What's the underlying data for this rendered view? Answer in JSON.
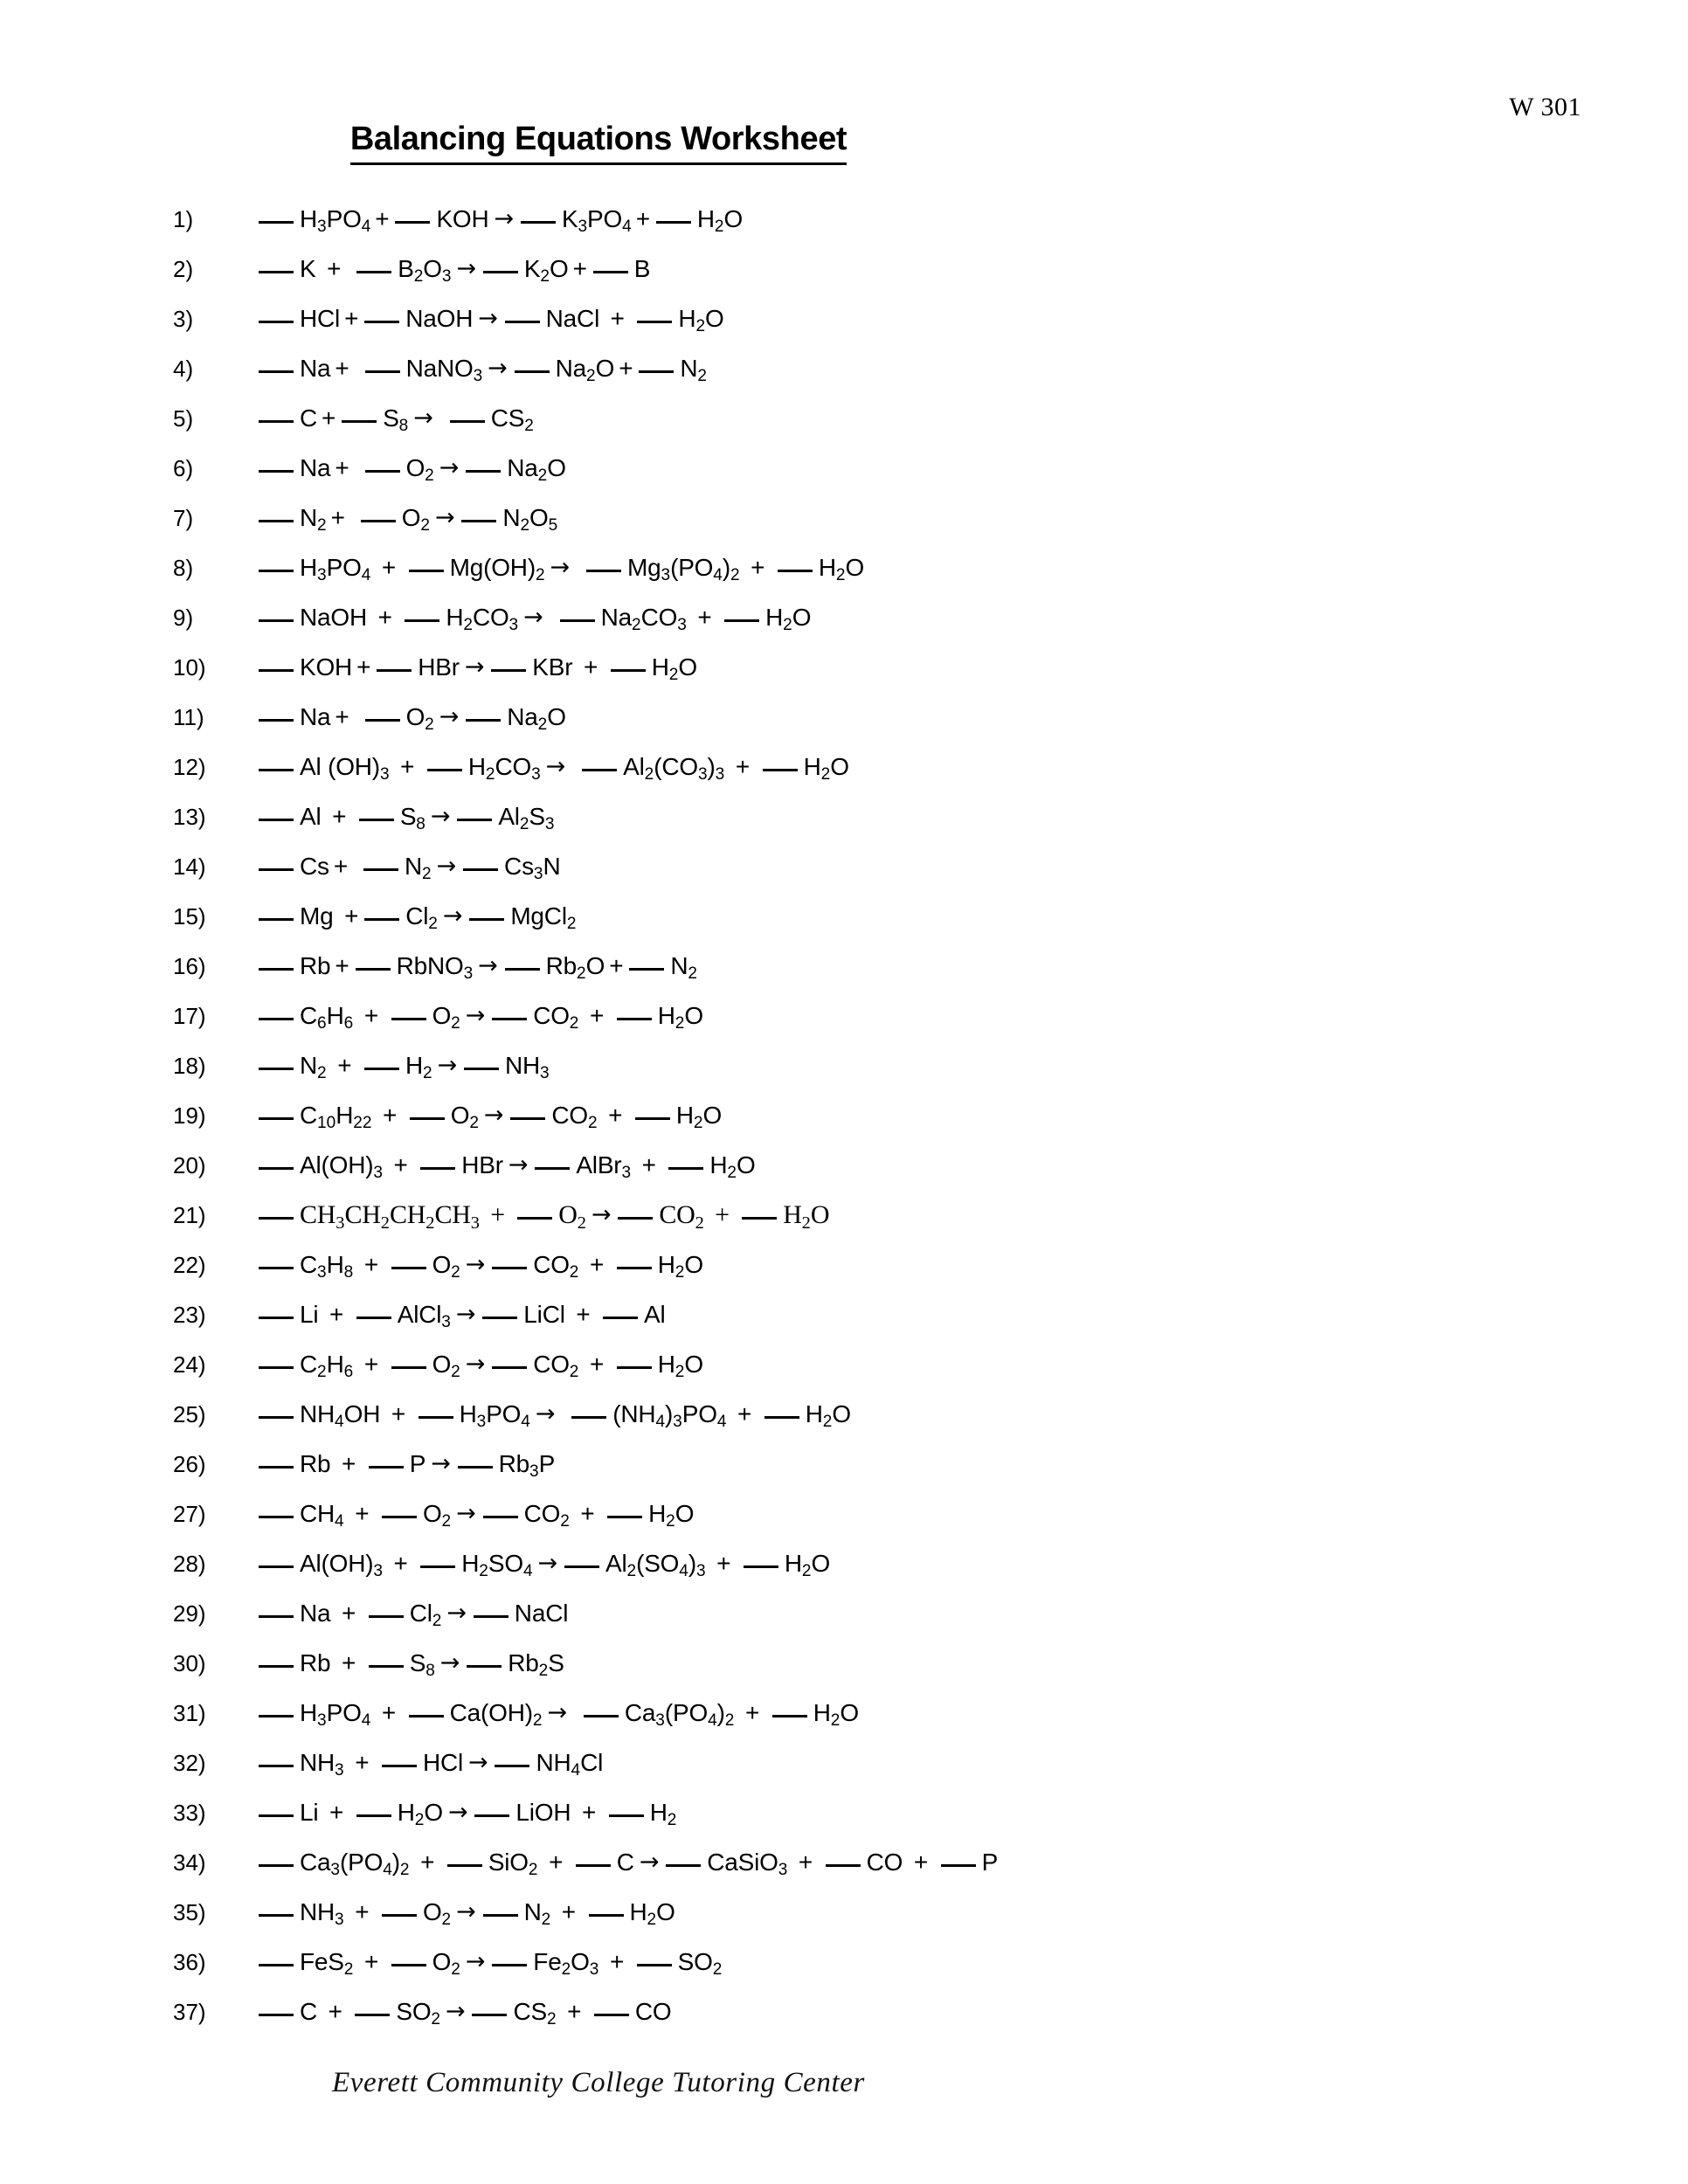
{
  "header": {
    "doc_code": "W 301",
    "title": "Balancing Equations Worksheet"
  },
  "footer": {
    "text": "Everett Community College Tutoring Center"
  },
  "symbols": {
    "plus": "+",
    "arrow": "→",
    "blank": "___"
  },
  "equations": [
    {
      "number": "1)",
      "text": "___ H3PO4 + ___ KOH → ___ K3PO4 + ___ H2O",
      "reactants": [
        "H3PO4",
        "KOH"
      ],
      "products": [
        "K3PO4",
        "H2O"
      ],
      "html": "<span class='blank'></span>H<sub>3</sub>PO<sub>4</sub><span class='op'>+</span><span class='blank'></span>KOH<span class='arrow'>→</span><span class='blank'></span>K<sub>3</sub>PO<sub>4</sub><span class='op'>+</span><span class='blank'></span>H<sub>2</sub>O"
    },
    {
      "number": "2)",
      "text": "___ K + ___ B2O3 → ___ K2O + ___ B",
      "reactants": [
        "K",
        "B2O3"
      ],
      "products": [
        "K2O",
        "B"
      ],
      "html": "<span class='blank'></span>K<span class='op'>&nbsp;+</span><span class='sp'></span><span class='blank'></span>B<sub>2</sub>O<sub>3</sub><span class='arrow'>→</span><span class='blank'></span>K<sub>2</sub>O<span class='op'>+</span><span class='blank'></span>B"
    },
    {
      "number": "3)",
      "text": "___ HCl + ___ NaOH → ___ NaCl + ___ H2O",
      "reactants": [
        "HCl",
        "NaOH"
      ],
      "products": [
        "NaCl",
        "H2O"
      ],
      "html": "<span class='blank'></span>HCl<span class='op'>+</span><span class='blank'></span>NaOH<span class='arrow'>→</span><span class='blank'></span>NaCl<span class='op'>&nbsp;+&nbsp;</span><span class='blank'></span>H<sub>2</sub>O"
    },
    {
      "number": "4)",
      "text": "___ Na + ___ NaNO3 → ___ Na2O + ___ N2",
      "reactants": [
        "Na",
        "NaNO3"
      ],
      "products": [
        "Na2O",
        "N2"
      ],
      "html": "<span class='blank'></span>Na<span class='op'>+</span><span class='sp'></span><span class='blank'></span>NaNO<sub>3</sub><span class='arrow'>→</span><span class='blank'></span>Na<sub>2</sub>O<span class='op'>+</span><span class='blank'></span>N<sub>2</sub>"
    },
    {
      "number": "5)",
      "text": "___ C + ___ S8 → ___ CS2",
      "reactants": [
        "C",
        "S8"
      ],
      "products": [
        "CS2"
      ],
      "html": "<span class='blank'></span>C<span class='op'>+</span><span class='blank'></span>S<sub>8</sub><span class='arrow'>→</span><span class='sp'></span><span class='blank'></span>CS<sub>2</sub>"
    },
    {
      "number": "6)",
      "text": "___ Na + ___ O2 → ___ Na2O",
      "reactants": [
        "Na",
        "O2"
      ],
      "products": [
        "Na2O"
      ],
      "html": "<span class='blank'></span>Na<span class='op'>+</span><span class='sp'></span><span class='blank'></span>O<sub>2</sub><span class='arrow'>→</span><span class='blank'></span>Na<sub>2</sub>O"
    },
    {
      "number": "7)",
      "text": "___ N2 + ___ O2 → ___ N2O5",
      "reactants": [
        "N2",
        "O2"
      ],
      "products": [
        "N2O5"
      ],
      "html": "<span class='blank'></span>N<sub>2</sub><span class='op'>+</span><span class='sp'></span><span class='blank'></span>O<sub>2</sub><span class='arrow'>→</span><span class='blank'></span>N<sub>2</sub>O<sub>5</sub>"
    },
    {
      "number": "8)",
      "text": "___ H3PO4 + ___ Mg(OH)2 → ___ Mg3(PO4)2 + ___ H2O",
      "reactants": [
        "H3PO4",
        "Mg(OH)2"
      ],
      "products": [
        "Mg3(PO4)2",
        "H2O"
      ],
      "html": "<span class='blank'></span>H<sub>3</sub>PO<sub>4</sub><span class='op'>&nbsp;+&nbsp;</span><span class='blank'></span>Mg(OH)<sub>2</sub><span class='arrow'>→</span><span class='sp'></span><span class='blank'></span>Mg<sub>3</sub>(PO<sub>4</sub>)<sub>2</sub><span class='op'>&nbsp;+&nbsp;</span><span class='blank'></span>H<sub>2</sub>O"
    },
    {
      "number": "9)",
      "text": "___ NaOH + ___ H2CO3 → ___ Na2CO3 + ___ H2O",
      "reactants": [
        "NaOH",
        "H2CO3"
      ],
      "products": [
        "Na2CO3",
        "H2O"
      ],
      "html": "<span class='blank'></span>NaOH<span class='op'>&nbsp;+&nbsp;</span><span class='blank'></span>H<sub>2</sub>CO<sub>3</sub><span class='arrow'>→</span><span class='sp'></span><span class='blank'></span>Na<sub>2</sub>CO<sub>3</sub><span class='op'>&nbsp;+&nbsp;</span><span class='blank'></span>H<sub>2</sub>O"
    },
    {
      "number": "10)",
      "text": "___ KOH + ___ HBr → ___ KBr + ___ H2O",
      "reactants": [
        "KOH",
        "HBr"
      ],
      "products": [
        "KBr",
        "H2O"
      ],
      "html": "<span class='blank'></span>KOH<span class='op'>+</span><span class='blank'></span>HBr<span class='arrow'>→</span><span class='blank'></span>KBr<span class='op'>&nbsp;+&nbsp;</span><span class='blank'></span>H<sub>2</sub>O"
    },
    {
      "number": "11)",
      "text": "___ Na + ___ O2 → ___ Na2O",
      "reactants": [
        "Na",
        "O2"
      ],
      "products": [
        "Na2O"
      ],
      "html": "<span class='blank'></span>Na<span class='op'>+</span><span class='sp'></span><span class='blank'></span>O<sub>2</sub><span class='arrow'>→</span><span class='blank'></span>Na<sub>2</sub>O"
    },
    {
      "number": "12)",
      "text": "___ Al (OH)3 + ___ H2CO3 → ___ Al2(CO3)3 + ___ H2O",
      "reactants": [
        "Al (OH)3",
        "H2CO3"
      ],
      "products": [
        "Al2(CO3)3",
        "H2O"
      ],
      "html": "<span class='blank'></span>Al (OH)<sub>3</sub><span class='op'>&nbsp;+&nbsp;</span><span class='blank'></span>H<sub>2</sub>CO<sub>3</sub><span class='arrow'>→</span><span class='sp'></span><span class='blank'></span>Al<sub>2</sub>(CO<sub>3</sub>)<sub>3</sub><span class='op'>&nbsp;+&nbsp;</span><span class='blank'></span>H<sub>2</sub>O"
    },
    {
      "number": "13)",
      "text": "___ Al + ___ S8 → ___ Al2S3",
      "reactants": [
        "Al",
        "S8"
      ],
      "products": [
        "Al2S3"
      ],
      "html": "<span class='blank'></span>Al<span class='op'>&nbsp;+&nbsp;</span><span class='blank'></span>S<sub>8</sub><span class='arrow'>→</span><span class='blank'></span>Al<sub>2</sub>S<sub>3</sub>"
    },
    {
      "number": "14)",
      "text": "___ Cs + ___ N2 → ___ Cs3N",
      "reactants": [
        "Cs",
        "N2"
      ],
      "products": [
        "Cs3N"
      ],
      "html": "<span class='blank'></span>Cs<span class='op'>+</span><span class='sp'></span><span class='blank'></span>N<sub>2</sub><span class='arrow'>→</span><span class='blank'></span>Cs<sub>3</sub>N"
    },
    {
      "number": "15)",
      "text": "___ Mg + ___ Cl2 → ___ MgCl2",
      "reactants": [
        "Mg",
        "Cl2"
      ],
      "products": [
        "MgCl2"
      ],
      "html": "<span class='blank'></span>Mg<span class='op'>&nbsp;+</span><span class='blank'></span>Cl<sub>2</sub><span class='arrow'>→</span><span class='blank'></span>MgCl<sub>2</sub>"
    },
    {
      "number": "16)",
      "text": "___ Rb + ___ RbNO3 → ___ Rb2O + ___ N2",
      "reactants": [
        "Rb",
        "RbNO3"
      ],
      "products": [
        "Rb2O",
        "N2"
      ],
      "html": "<span class='blank'></span>Rb<span class='op'>+</span><span class='blank'></span>RbNO<sub>3</sub><span class='arrow'>→</span><span class='blank'></span>Rb<sub>2</sub>O<span class='op'>+</span><span class='blank'></span>N<sub>2</sub>"
    },
    {
      "number": "17)",
      "text": "___ C6H6 + ___ O2 → ___ CO2 + ___ H2O",
      "reactants": [
        "C6H6",
        "O2"
      ],
      "products": [
        "CO2",
        "H2O"
      ],
      "html": "<span class='blank'></span>C<sub>6</sub>H<sub>6</sub><span class='op'>&nbsp;+&nbsp;</span><span class='blank'></span>O<sub>2</sub><span class='arrow'>→</span><span class='blank'></span>CO<sub>2</sub><span class='op'>&nbsp;+&nbsp;</span><span class='blank'></span>H<sub>2</sub>O"
    },
    {
      "number": "18)",
      "text": "___ N2 + ___ H2 → ___ NH3",
      "reactants": [
        "N2",
        "H2"
      ],
      "products": [
        "NH3"
      ],
      "html": "<span class='blank'></span>N<sub>2</sub><span class='op'>&nbsp;+&nbsp;</span><span class='blank'></span>H<sub>2</sub><span class='arrow'>→</span><span class='blank'></span>NH<sub>3</sub>"
    },
    {
      "number": "19)",
      "text": "___ C10H22 + ___ O2 → ___ CO2 + ___ H2O",
      "reactants": [
        "C10H22",
        "O2"
      ],
      "products": [
        "CO2",
        "H2O"
      ],
      "html": "<span class='blank'></span>C<sub>10</sub>H<sub>22</sub><span class='op'>&nbsp;+&nbsp;</span><span class='blank'></span>O<sub>2</sub><span class='arrow'>→</span><span class='blank'></span>CO<sub>2</sub><span class='op'>&nbsp;+&nbsp;</span><span class='blank'></span>H<sub>2</sub>O"
    },
    {
      "number": "20)",
      "text": "___ Al(OH)3 + ___ HBr → ___ AlBr3 + ___ H2O",
      "reactants": [
        "Al(OH)3",
        "HBr"
      ],
      "products": [
        "AlBr3",
        "H2O"
      ],
      "html": "<span class='blank'></span>Al(OH)<sub>3</sub><span class='op'>&nbsp;+&nbsp;</span><span class='blank'></span>HBr<span class='arrow'>→</span><span class='blank'></span>AlBr<sub>3</sub><span class='op'>&nbsp;+&nbsp;</span><span class='blank'></span>H<sub>2</sub>O"
    },
    {
      "number": "21)",
      "serif": true,
      "text": "___ CH3CH2CH2CH3 + ___ O2 → ___ CO2 + ___ H2O",
      "reactants": [
        "CH3CH2CH2CH3",
        "O2"
      ],
      "products": [
        "CO2",
        "H2O"
      ],
      "html": "<span class='blank'></span>CH<sub>3</sub>CH<sub>2</sub>CH<sub>2</sub>CH<sub>3</sub><span class='op'>&nbsp;+&nbsp;</span><span class='blank'></span>O<sub>2</sub><span class='arrow'>→</span><span class='blank'></span>CO<sub>2</sub><span class='op'>&nbsp;+&nbsp;</span><span class='blank'></span>H<sub>2</sub>O"
    },
    {
      "number": "22)",
      "text": "___ C3H8 + ___ O2 → ___ CO2 + ___ H2O",
      "reactants": [
        "C3H8",
        "O2"
      ],
      "products": [
        "CO2",
        "H2O"
      ],
      "html": "<span class='blank'></span>C<sub>3</sub>H<sub>8</sub><span class='op'>&nbsp;+&nbsp;</span><span class='blank'></span>O<sub>2</sub><span class='arrow'>→</span><span class='blank'></span>CO<sub>2</sub><span class='op'>&nbsp;+&nbsp;</span><span class='blank'></span>H<sub>2</sub>O"
    },
    {
      "number": "23)",
      "text": "___ Li + ___ AlCl3 → ___ LiCl + ___ Al",
      "reactants": [
        "Li",
        "AlCl3"
      ],
      "products": [
        "LiCl",
        "Al"
      ],
      "html": "<span class='blank'></span>Li<span class='op'>&nbsp;+&nbsp;</span><span class='blank'></span>AlCl<sub>3</sub><span class='arrow'>→</span><span class='blank'></span>LiCl<span class='op'>&nbsp;+&nbsp;</span><span class='blank'></span>Al"
    },
    {
      "number": "24)",
      "text": "___ C2H6 + ___ O2 → ___ CO2 + ___ H2O",
      "reactants": [
        "C2H6",
        "O2"
      ],
      "products": [
        "CO2",
        "H2O"
      ],
      "html": "<span class='blank'></span>C<sub>2</sub>H<sub>6</sub><span class='op'>&nbsp;+&nbsp;</span><span class='blank'></span>O<sub>2</sub><span class='arrow'>→</span><span class='blank'></span>CO<sub>2</sub><span class='op'>&nbsp;+&nbsp;</span><span class='blank'></span>H<sub>2</sub>O"
    },
    {
      "number": "25)",
      "text": "___ NH4OH + ___ H3PO4 → ___ (NH4)3PO4 + ___ H2O",
      "reactants": [
        "NH4OH",
        "H3PO4"
      ],
      "products": [
        "(NH4)3PO4",
        "H2O"
      ],
      "html": "<span class='blank'></span>NH<sub>4</sub>OH<span class='op'>&nbsp;+&nbsp;</span><span class='blank'></span>H<sub>3</sub>PO<sub>4</sub><span class='arrow'>→</span><span class='sp'></span><span class='blank'></span>(NH<sub>4</sub>)<sub>3</sub>PO<sub>4</sub><span class='op'>&nbsp;+&nbsp;</span><span class='blank'></span>H<sub>2</sub>O"
    },
    {
      "number": "26)",
      "text": "___ Rb + ___ P → ___ Rb3P",
      "reactants": [
        "Rb",
        "P"
      ],
      "products": [
        "Rb3P"
      ],
      "html": "<span class='blank'></span>Rb<span class='op'>&nbsp;+&nbsp;</span><span class='blank'></span>P<span class='arrow'>→</span><span class='blank'></span>Rb<sub>3</sub>P"
    },
    {
      "number": "27)",
      "text": "___ CH4 + ___ O2 → ___ CO2 + ___ H2O",
      "reactants": [
        "CH4",
        "O2"
      ],
      "products": [
        "CO2",
        "H2O"
      ],
      "html": "<span class='blank'></span>CH<sub>4</sub><span class='op'>&nbsp;+&nbsp;</span><span class='blank'></span>O<sub>2</sub><span class='arrow'>→</span><span class='blank'></span>CO<sub>2</sub><span class='op'>&nbsp;+&nbsp;</span><span class='blank'></span>H<sub>2</sub>O"
    },
    {
      "number": "28)",
      "text": "___ Al(OH)3 + ___ H2SO4 → ___ Al2(SO4)3 + ___ H2O",
      "reactants": [
        "Al(OH)3",
        "H2SO4"
      ],
      "products": [
        "Al2(SO4)3",
        "H2O"
      ],
      "html": "<span class='blank'></span>Al(OH)<sub>3</sub><span class='op'>&nbsp;+&nbsp;</span><span class='blank'></span>H<sub>2</sub>SO<sub>4</sub><span class='arrow'>→</span><span class='blank'></span>Al<sub>2</sub>(SO<sub>4</sub>)<sub>3</sub><span class='op'>&nbsp;+&nbsp;</span><span class='blank'></span>H<sub>2</sub>O"
    },
    {
      "number": "29)",
      "text": "___ Na + ___ Cl2 → ___ NaCl",
      "reactants": [
        "Na",
        "Cl2"
      ],
      "products": [
        "NaCl"
      ],
      "html": "<span class='blank'></span>Na<span class='op'>&nbsp;+&nbsp;</span><span class='blank'></span>Cl<sub>2</sub><span class='arrow'>→</span><span class='blank'></span>NaCl"
    },
    {
      "number": "30)",
      "text": "___ Rb + ___ S8 → ___ Rb2S",
      "reactants": [
        "Rb",
        "S8"
      ],
      "products": [
        "Rb2S"
      ],
      "html": "<span class='blank'></span>Rb<span class='op'>&nbsp;+&nbsp;</span><span class='blank'></span>S<sub>8</sub><span class='arrow'>→</span><span class='blank'></span>Rb<sub>2</sub>S"
    },
    {
      "number": "31)",
      "text": "___ H3PO4 + ___ Ca(OH)2 → ___ Ca3(PO4)2 + ___ H2O",
      "reactants": [
        "H3PO4",
        "Ca(OH)2"
      ],
      "products": [
        "Ca3(PO4)2",
        "H2O"
      ],
      "html": "<span class='blank'></span>H<sub>3</sub>PO<sub>4</sub><span class='op'>&nbsp;+&nbsp;</span><span class='blank'></span>Ca(OH)<sub>2</sub><span class='arrow'>→</span><span class='sp'></span><span class='blank'></span>Ca<sub>3</sub>(PO<sub>4</sub>)<sub>2</sub><span class='op'>&nbsp;+&nbsp;</span><span class='blank'></span>H<sub>2</sub>O"
    },
    {
      "number": "32)",
      "text": "___ NH3 + ___ HCl → ___ NH4Cl",
      "reactants": [
        "NH3",
        "HCl"
      ],
      "products": [
        "NH4Cl"
      ],
      "html": "<span class='blank'></span>NH<sub>3</sub><span class='op'>&nbsp;+&nbsp;</span><span class='blank'></span>HCl<span class='arrow'>→</span><span class='blank'></span>NH<sub>4</sub>Cl"
    },
    {
      "number": "33)",
      "text": "___ Li + ___ H2O → ___ LiOH + ___ H2",
      "reactants": [
        "Li",
        "H2O"
      ],
      "products": [
        "LiOH",
        "H2"
      ],
      "html": "<span class='blank'></span>Li<span class='op'>&nbsp;+&nbsp;</span><span class='blank'></span>H<sub>2</sub>O<span class='arrow'>→</span><span class='blank'></span>LiOH<span class='op'>&nbsp;+&nbsp;</span><span class='blank'></span>H<sub>2</sub>"
    },
    {
      "number": "34)",
      "text": "___ Ca3(PO4)2 + ___ SiO2 + ___ C → ___ CaSiO3 + ___ CO + ___ P",
      "reactants": [
        "Ca3(PO4)2",
        "SiO2",
        "C"
      ],
      "products": [
        "CaSiO3",
        "CO",
        "P"
      ],
      "html": "<span class='blank'></span>Ca<sub>3</sub>(PO<sub>4</sub>)<sub>2</sub><span class='op'>&nbsp;+&nbsp;</span><span class='blank'></span>SiO<sub>2</sub><span class='op'>&nbsp;+&nbsp;</span><span class='blank'></span>C<span class='arrow'>→</span><span class='blank'></span>CaSiO<sub>3</sub><span class='op'>&nbsp;+&nbsp;</span><span class='blank'></span>CO<span class='op'>&nbsp;+&nbsp;</span><span class='blank'></span>P"
    },
    {
      "number": "35)",
      "text": "___ NH3 + ___ O2 → ___ N2 + ___ H2O",
      "reactants": [
        "NH3",
        "O2"
      ],
      "products": [
        "N2",
        "H2O"
      ],
      "html": "<span class='blank'></span>NH<sub>3</sub><span class='op'>&nbsp;+&nbsp;</span><span class='blank'></span>O<sub>2</sub><span class='arrow'>→</span><span class='blank'></span>N<sub>2</sub><span class='op'>&nbsp;+&nbsp;</span><span class='blank'></span>H<sub>2</sub>O"
    },
    {
      "number": "36)",
      "text": "___ FeS2 + ___ O2 → ___ Fe2O3 + ___ SO2",
      "reactants": [
        "FeS2",
        "O2"
      ],
      "products": [
        "Fe2O3",
        "SO2"
      ],
      "html": "<span class='blank'></span>FeS<sub>2</sub><span class='op'>&nbsp;+&nbsp;</span><span class='blank'></span>O<sub>2</sub><span class='arrow'>→</span><span class='blank'></span>Fe<sub>2</sub>O<sub>3</sub><span class='op'>&nbsp;+&nbsp;</span><span class='blank'></span>SO<sub>2</sub>"
    },
    {
      "number": "37)",
      "text": "___ C + ___ SO2 → ___ CS2 + ___ CO",
      "reactants": [
        "C",
        "SO2"
      ],
      "products": [
        "CS2",
        "CO"
      ],
      "html": "<span class='blank'></span>C<span class='op'>&nbsp;+&nbsp;</span><span class='blank'></span>SO<sub>2</sub><span class='arrow'>→</span><span class='blank'></span>CS<sub>2</sub><span class='op'>&nbsp;+&nbsp;</span><span class='blank'></span>CO"
    }
  ]
}
